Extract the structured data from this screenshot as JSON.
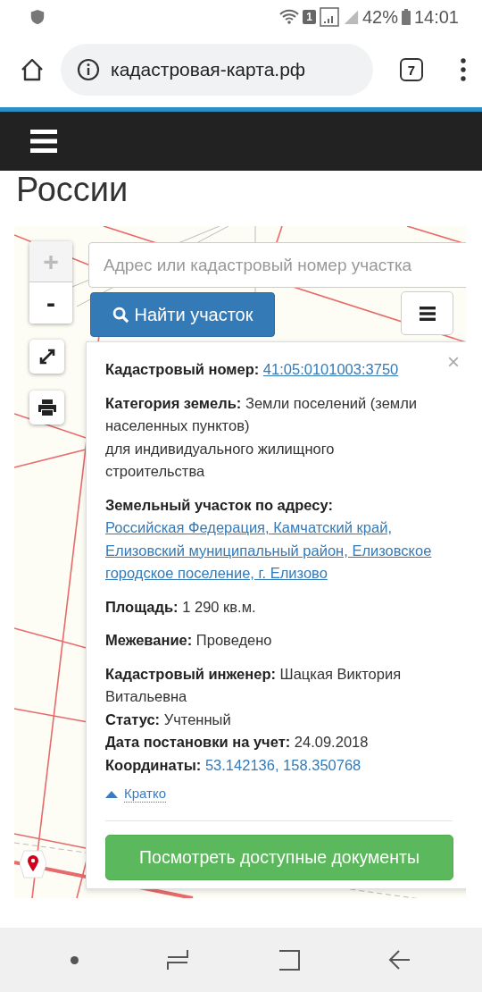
{
  "status_bar": {
    "sim": "1",
    "battery": "42%",
    "time": "14:01"
  },
  "browser": {
    "url": "кадастровая-карта.рф",
    "tab_count": "7"
  },
  "page_heading": "России",
  "map": {
    "zoom_in": "+",
    "zoom_out": "-",
    "search": {
      "placeholder": "Адрес или кадастровый номер участка"
    },
    "find_button": "Найти участок"
  },
  "popup": {
    "close": "×",
    "sections": [
      [
        {
          "label": "Кадастровый номер:",
          "value": "41:05:0101003:3750",
          "kind": "link"
        }
      ],
      [
        {
          "label": "Категория земель:",
          "value": "Земли поселений (земли населенных пунктов)\nдля индивидуального жилищного строительства",
          "kind": "text"
        }
      ],
      [
        {
          "label": "Земельный участок по адресу:",
          "value": "Российская Федерация, Камчатский край, Елизовский муниципальный район, Елизовское городское поселение, г. Елизово",
          "kind": "address"
        }
      ],
      [
        {
          "label": "Площадь:",
          "value": "1 290 кв.м.",
          "kind": "text"
        }
      ],
      [
        {
          "label": "Межевание:",
          "value": "Проведено",
          "kind": "text"
        }
      ],
      [
        {
          "label": "Кадастровый инженер:",
          "value": "Шацкая Виктория Витальевна",
          "kind": "text"
        },
        {
          "label": "Статус:",
          "value": "Учтенный",
          "kind": "text"
        },
        {
          "label": "Дата постановки на учет:",
          "value": "24.09.2018",
          "kind": "text"
        },
        {
          "label": "Координаты:",
          "value": "53.142136, 158.350768",
          "kind": "coords"
        }
      ]
    ],
    "toggle": {
      "label": "Кратко",
      "expanded": true
    },
    "documents_button": "Посмотреть доступные документы"
  }
}
